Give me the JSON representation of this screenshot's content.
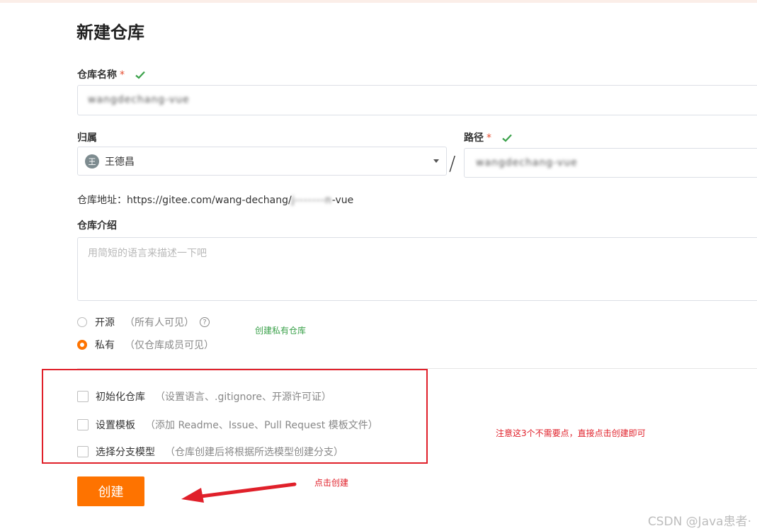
{
  "page_title": "新建仓库",
  "repo_name": {
    "label": "仓库名称",
    "required_mark": "*",
    "value": "wangdechang-vue"
  },
  "owner": {
    "label": "归属",
    "avatar_text": "王",
    "value": "王德昌"
  },
  "path": {
    "label": "路径",
    "required_mark": "*",
    "separator": "/",
    "value": "wangdechang-vue"
  },
  "address": {
    "label": "仓库地址：",
    "url_prefix": "https://gitee.com/wang-dechang/",
    "url_blurred": "j-------n",
    "url_suffix": "-vue"
  },
  "description": {
    "label": "仓库介绍",
    "placeholder": "用简短的语言来描述一下吧"
  },
  "visibility": {
    "public": {
      "label": "开源",
      "hint": "（所有人可见）",
      "help": "?"
    },
    "private": {
      "label": "私有",
      "hint": "（仅仓库成员可见）"
    },
    "selected": "private"
  },
  "annotations": {
    "private_note": "创建私有仓库",
    "options_note": "注意这3个不需要点，直接点击创建即可",
    "create_note": "点击创建"
  },
  "options": [
    {
      "label": "初始化仓库",
      "hint": "（设置语言、.gitignore、开源许可证）"
    },
    {
      "label": "设置模板",
      "hint": "（添加 Readme、Issue、Pull Request 模板文件）"
    },
    {
      "label": "选择分支模型",
      "hint": "（仓库创建后将根据所选模型创建分支）"
    }
  ],
  "create_button": "创建",
  "watermark": "CSDN @Java患者·",
  "colors": {
    "accent": "#fe7300",
    "annotation_red": "#e0202a",
    "annotation_green": "#3aa14a"
  }
}
